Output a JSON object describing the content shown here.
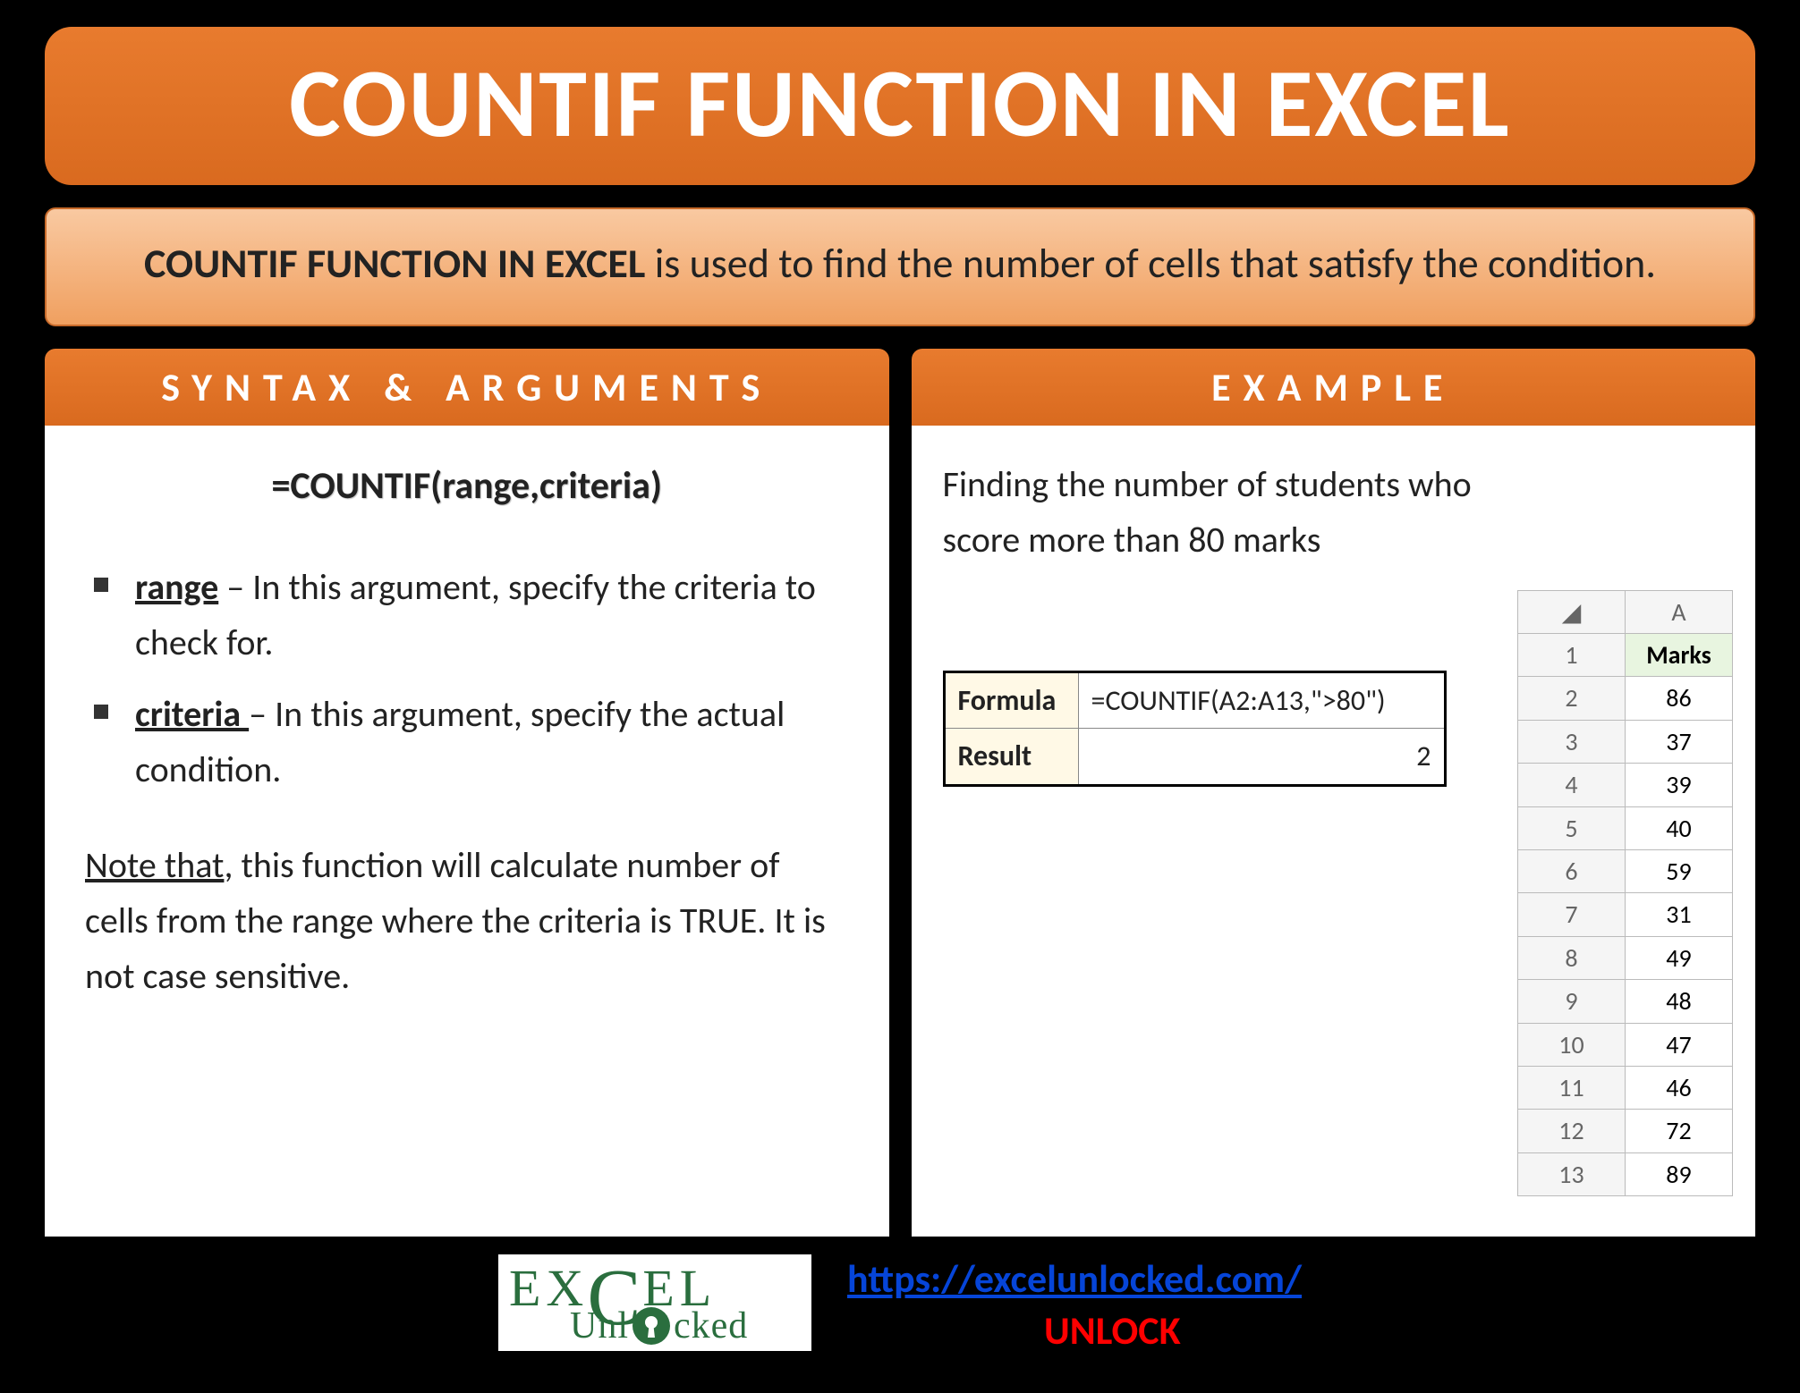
{
  "title": "COUNTIF FUNCTION IN EXCEL",
  "description": {
    "bold_lead": "COUNTIF FUNCTION IN EXCEL",
    "rest": " is used to find the number of cells that satisfy the condition."
  },
  "left": {
    "header": "SYNTAX & ARGUMENTS",
    "formula": "=COUNTIF(range,criteria)",
    "args": [
      {
        "name": "range",
        "text": " – In this argument, specify the criteria to check for."
      },
      {
        "name": "criteria ",
        "text": "– In this argument, specify the actual condition."
      }
    ],
    "note_lead": "Note that",
    "note_rest": ", this function will calculate number of cells from the range where the criteria is TRUE. It is not case sensitive."
  },
  "right": {
    "header": "EXAMPLE",
    "intro": "Finding the number of students who score more than 80 marks",
    "formula_label": "Formula",
    "formula_value": "=COUNTIF(A2:A13,\">80\")",
    "result_label": "Result",
    "result_value": "2",
    "marks_col_letter": "A",
    "marks_header": "Marks",
    "marks": [
      "86",
      "37",
      "39",
      "40",
      "59",
      "31",
      "49",
      "48",
      "47",
      "46",
      "72",
      "89"
    ]
  },
  "footer": {
    "logo_top": "EX EL",
    "logo_bottom_left": "Unl",
    "logo_bottom_right": "cked",
    "url": "https://excelunlocked.com/",
    "unlock": "UNLOCK"
  }
}
